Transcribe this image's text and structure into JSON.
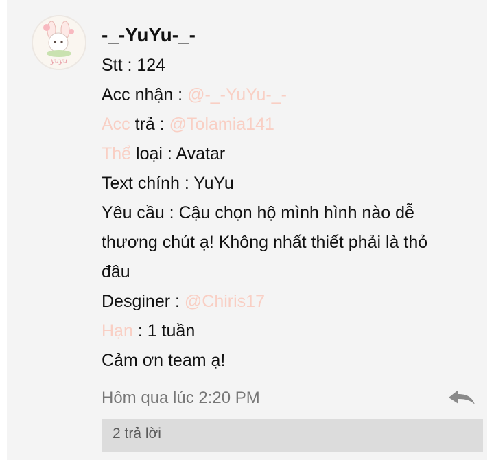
{
  "post": {
    "username": "-_-YuYu-_-",
    "avatar_text": "yuyu",
    "lines": {
      "stt": "Stt : 124",
      "acc_nhan_label": "Acc nhận : ",
      "acc_nhan_mention": "@-_-YuYu-_-",
      "acc_tra_word": "Acc",
      "acc_tra_label": " trả : ",
      "acc_tra_mention": "@Tolamia141",
      "the_loai_word": "Thể",
      "the_loai_label": " loại : Avatar",
      "text_chinh": "Text chính : YuYu",
      "yeu_cau_1": "Yêu cầu : Cậu chọn hộ mình hình nào dễ",
      "yeu_cau_2": "thương chút ạ! Không nhất thiết phải là thỏ",
      "yeu_cau_3": "đâu",
      "designer_label": "Desginer : ",
      "designer_mention": "@Chiris17",
      "han_word": "Hạn",
      "han_label": " : 1 tuần",
      "thanks": "Cảm ơn team ạ!"
    },
    "timestamp": "Hôm qua lúc 2:20 PM",
    "reply_icon": "reply-arrow-icon",
    "replies_label": "2 trả lời"
  },
  "colors": {
    "mention": "#f9cfc4",
    "card_bg": "#f4f4f4",
    "replies_bg": "#dcdcdc"
  }
}
